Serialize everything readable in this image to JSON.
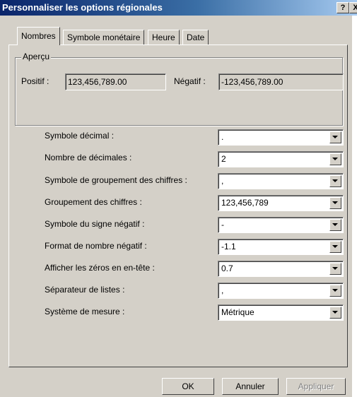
{
  "window": {
    "title": "Personnaliser les options régionales",
    "help_button": "?",
    "close_button": "X"
  },
  "tabs": [
    {
      "label": "Nombres",
      "active": true
    },
    {
      "label": "Symbole monétaire",
      "active": false
    },
    {
      "label": "Heure",
      "active": false
    },
    {
      "label": "Date",
      "active": false
    }
  ],
  "preview": {
    "legend": "Aperçu",
    "positive_label": "Positif :",
    "positive_value": "123,456,789.00",
    "negative_label": "Négatif :",
    "negative_value": "-123,456,789.00"
  },
  "settings": [
    {
      "label": "Symbole décimal :",
      "value": "."
    },
    {
      "label": "Nombre de décimales :",
      "value": "2"
    },
    {
      "label": "Symbole de groupement des chiffres :",
      "value": ","
    },
    {
      "label": "Groupement des chiffres :",
      "value": "123,456,789"
    },
    {
      "label": "Symbole du signe négatif :",
      "value": "-"
    },
    {
      "label": "Format de nombre négatif :",
      "value": "-1.1"
    },
    {
      "label": "Afficher les zéros en en-tête :",
      "value": "0.7"
    },
    {
      "label": "Séparateur de listes :",
      "value": ","
    },
    {
      "label": "Système de mesure :",
      "value": "Métrique"
    }
  ],
  "buttons": {
    "ok": "OK",
    "cancel": "Annuler",
    "apply": "Appliquer"
  },
  "colors": {
    "dialog_bg": "#d4d0c8",
    "titlebar_start": "#0a246a",
    "titlebar_end": "#a6caf0"
  }
}
